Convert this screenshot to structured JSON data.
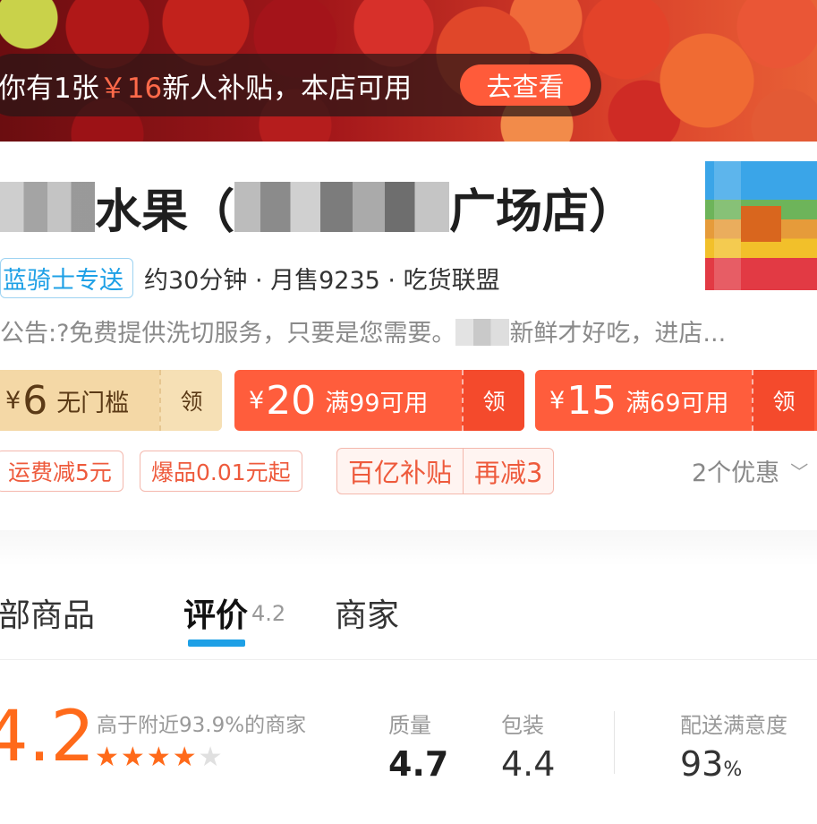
{
  "banner": {
    "promo_prefix": "你有1张",
    "promo_amount": "￥16",
    "promo_suffix": "新人补贴，本店可用",
    "promo_button": "去查看"
  },
  "shop": {
    "name_part1": "水果（",
    "name_part2": "广场店）",
    "delivery_tag": "蓝骑士专送",
    "meta": "约30分钟 · 月售9235 · 吃货联盟",
    "notice_part1": "公告:?免费提供洗切服务，只要是您需要。",
    "notice_part2": "新鲜才好吃，进店..."
  },
  "coupons": [
    {
      "currency": "¥",
      "amount": "6",
      "condition": "无门槛",
      "claim": "领"
    },
    {
      "currency": "¥",
      "amount": "20",
      "condition": "满99可用",
      "claim": "领"
    },
    {
      "currency": "¥",
      "amount": "15",
      "condition": "满69可用",
      "claim": "领"
    }
  ],
  "tags": {
    "shipping": "运费减5元",
    "hot": "爆品0.01元起",
    "subsidy": "百亿补贴",
    "subsidy_extra": "再减3",
    "discounts": "2个优惠"
  },
  "tabs": {
    "all": "部商品",
    "reviews": "评价",
    "reviews_score": "4.2",
    "merchant": "商家"
  },
  "ratings": {
    "overall": "4.2",
    "stars_value": 4.2,
    "higher_than": "高于附近93.9%的商家",
    "quality_label": "质量",
    "quality_value": "4.7",
    "packaging_label": "包装",
    "packaging_value": "4.4",
    "delivery_label": "配送满意度",
    "delivery_value": "93",
    "delivery_unit": "%"
  },
  "colors": {
    "accent_orange": "#ff6a1a",
    "coupon_red": "#ff5d3c",
    "tab_blue": "#1ea0e6"
  }
}
